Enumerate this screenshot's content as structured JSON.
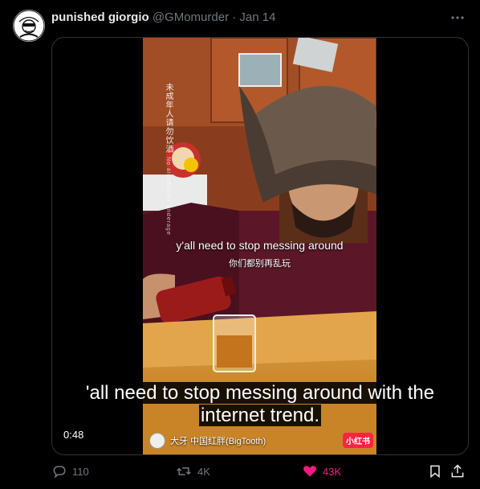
{
  "post": {
    "display_name": "punished giorgio",
    "handle": "@GMomurder",
    "separator": "·",
    "date": "Jan 14"
  },
  "video": {
    "timestamp": "0:48",
    "in_video_caption_en": "y'all need to stop messing around",
    "in_video_caption_cn": "你们都别再乱玩",
    "side_watermark": "未成年人请勿饮酒",
    "side_watermark_sub": "No alcohol for underage",
    "subtitle_line1": "'all need to stop messing around with the",
    "subtitle_line2": "internet trend.",
    "credit": "大牙 中国红胖(BigTooth)",
    "platform_badge": "小红书"
  },
  "actions": {
    "replies": "110",
    "reposts": "4K",
    "likes": "43K"
  },
  "colors": {
    "background": "#000000",
    "primary_text": "#e7e9ea",
    "secondary_text": "#71767b",
    "like_pink": "#f91880",
    "border": "#2f3336"
  },
  "icons": [
    "more-icon",
    "reply-icon",
    "repost-icon",
    "like-icon",
    "bookmark-icon",
    "share-icon"
  ]
}
